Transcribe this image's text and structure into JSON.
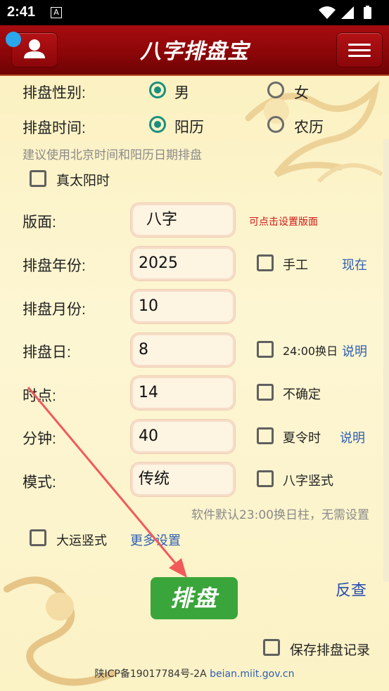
{
  "status_bar": {
    "time": "2:41",
    "notif": "A"
  },
  "app": {
    "title": "八字排盘宝"
  },
  "gender": {
    "label": "排盘性别:",
    "options": [
      "男",
      "女"
    ],
    "selected": "男"
  },
  "calendar": {
    "label": "排盘时间:",
    "options": [
      "阳历",
      "农历"
    ],
    "selected": "阳历"
  },
  "hint_beijing": "建议使用北京时间和阳历日期排盘",
  "true_solar": {
    "label": "真太阳时",
    "checked": false
  },
  "layout_field": {
    "label": "版面:",
    "value": "八字",
    "hint": "可点击设置版面"
  },
  "year": {
    "label": "排盘年份:",
    "value": "2025",
    "check_label": "手工",
    "link": "现在"
  },
  "month": {
    "label": "排盘月份:",
    "value": "10"
  },
  "day": {
    "label": "排盘日:",
    "value": "8",
    "check_label": "24:00换日",
    "link": "说明"
  },
  "hour": {
    "label": "时点:",
    "value": "14",
    "check_label": "不确定"
  },
  "minute": {
    "label": "分钟:",
    "value": "40",
    "check_label": "夏令时",
    "link": "说明"
  },
  "mode": {
    "label": "模式:",
    "value": "传统",
    "check_label": "八字竖式"
  },
  "hint_default": "软件默认23:00换日柱，无需设置",
  "dayun": {
    "label": "大运竖式",
    "link": "更多设置"
  },
  "paipan_button": "排盘",
  "reverse_link": "反查",
  "save_record": {
    "label": "保存排盘记录",
    "checked": false
  },
  "footer": {
    "icp": "陕ICP备19017784号-2A",
    "link": "beian.miit.gov.cn"
  },
  "colors": {
    "appbar": "#8d0608",
    "accent": "#1a8f7f",
    "button": "#3aa53a",
    "link": "#2f5fb3"
  }
}
